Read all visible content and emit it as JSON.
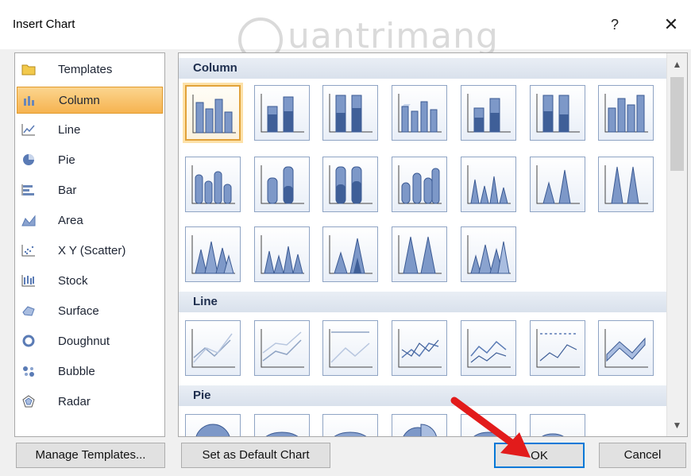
{
  "dialog": {
    "title": "Insert Chart",
    "help_label": "?",
    "close_label": "✕",
    "watermark": "uantrimang"
  },
  "sidebar": {
    "items": [
      {
        "label": "Templates",
        "icon": "folder-icon"
      },
      {
        "label": "Column",
        "icon": "column-chart-icon",
        "selected": true
      },
      {
        "label": "Line",
        "icon": "line-chart-icon"
      },
      {
        "label": "Pie",
        "icon": "pie-chart-icon"
      },
      {
        "label": "Bar",
        "icon": "bar-chart-icon"
      },
      {
        "label": "Area",
        "icon": "area-chart-icon"
      },
      {
        "label": "X Y (Scatter)",
        "icon": "scatter-chart-icon"
      },
      {
        "label": "Stock",
        "icon": "stock-chart-icon"
      },
      {
        "label": "Surface",
        "icon": "surface-chart-icon"
      },
      {
        "label": "Doughnut",
        "icon": "doughnut-chart-icon"
      },
      {
        "label": "Bubble",
        "icon": "bubble-chart-icon"
      },
      {
        "label": "Radar",
        "icon": "radar-chart-icon"
      }
    ]
  },
  "gallery": {
    "sections": [
      {
        "title": "Column"
      },
      {
        "title": "Line"
      },
      {
        "title": "Pie"
      }
    ]
  },
  "buttons": {
    "manage_templates": "Manage Templates...",
    "set_default": "Set as Default Chart",
    "ok": "OK",
    "cancel": "Cancel"
  },
  "colors": {
    "accent_selected": "#f6b350",
    "ok_border": "#0078d7",
    "arrow": "#e21b1b"
  }
}
